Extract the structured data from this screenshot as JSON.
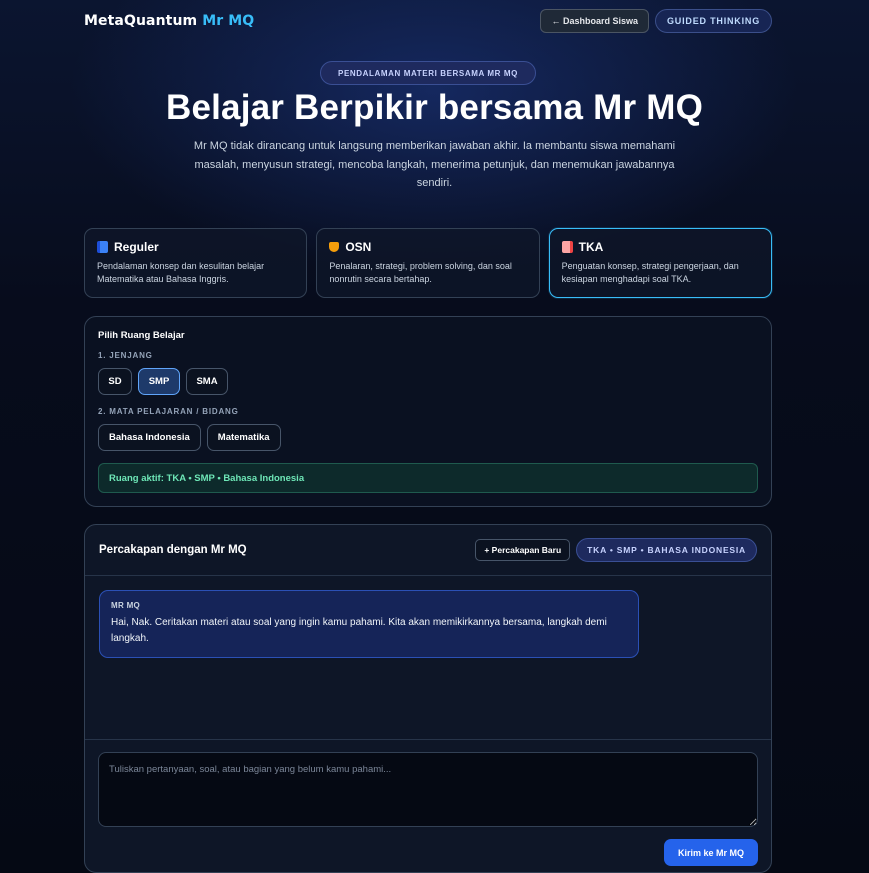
{
  "header": {
    "brand": "MetaQuantum",
    "brand_accent": "Mr MQ",
    "dashboard_button": "← Dashboard Siswa",
    "guided_badge": "GUIDED THINKING"
  },
  "hero": {
    "badge": "PENDALAMAN MATERI BERSAMA MR MQ",
    "title": "Belajar Berpikir bersama Mr MQ",
    "description": "Mr MQ tidak dirancang untuk langsung memberikan jawaban akhir. Ia membantu siswa memahami masalah, menyusun strategi, mencoba langkah, menerima petunjuk, dan menemukan jawabannya sendiri."
  },
  "tracks": [
    {
      "icon": "book-icon",
      "title": "Reguler",
      "description": "Pendalaman konsep dan kesulitan belajar Matematika atau Bahasa Inggris.",
      "active": false
    },
    {
      "icon": "trophy-icon",
      "title": "OSN",
      "description": "Penalaran, strategi, problem solving, dan soal nonrutin secara bertahap.",
      "active": false
    },
    {
      "icon": "document-icon",
      "title": "TKA",
      "description": "Penguatan konsep, strategi pengerjaan, dan kesiapan menghadapi soal TKA.",
      "active": true
    }
  ],
  "room": {
    "title": "Pilih Ruang Belajar",
    "level_label": "1. JENJANG",
    "levels": [
      "SD",
      "SMP",
      "SMA"
    ],
    "selected_level": "SMP",
    "subject_label": "2. MATA PELAJARAN / BIDANG",
    "subjects": [
      "Bahasa Indonesia",
      "Matematika"
    ],
    "active_room": "Ruang aktif: TKA • SMP • Bahasa Indonesia"
  },
  "chat": {
    "title": "Percakapan dengan Mr MQ",
    "new_button": "+ Percakapan Baru",
    "room_badge": "TKA • SMP • BAHASA INDONESIA",
    "messages": [
      {
        "sender": "MR MQ",
        "text": "Hai, Nak. Ceritakan materi atau soal yang ingin kamu pahami. Kita akan memikirkannya bersama, langkah demi langkah."
      }
    ],
    "input_placeholder": "Tuliskan pertanyaan, soal, atau bagian yang belum kamu pahami...",
    "send_button": "Kirim ke Mr MQ"
  },
  "colors": {
    "accent": "#38bdf8",
    "primary_button": "#2563eb",
    "active_room_text": "#6ee7b7"
  }
}
